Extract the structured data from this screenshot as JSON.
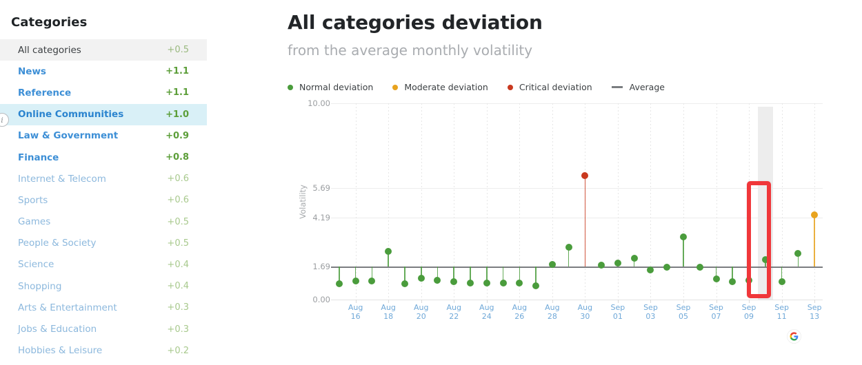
{
  "sidebar": {
    "title": "Categories",
    "info_icon": "info-icon",
    "items": [
      {
        "label": "All categories",
        "value": "+0.5",
        "style": "neutral"
      },
      {
        "label": "News",
        "value": "+1.1",
        "style": "strong"
      },
      {
        "label": "Reference",
        "value": "+1.1",
        "style": "strong"
      },
      {
        "label": "Online Communities",
        "value": "+1.0",
        "style": "sel"
      },
      {
        "label": "Law & Government",
        "value": "+0.9",
        "style": "strong"
      },
      {
        "label": "Finance",
        "value": "+0.8",
        "style": "strong"
      },
      {
        "label": "Internet & Telecom",
        "value": "+0.6",
        "style": "light"
      },
      {
        "label": "Sports",
        "value": "+0.6",
        "style": "light"
      },
      {
        "label": "Games",
        "value": "+0.5",
        "style": "light"
      },
      {
        "label": "People & Society",
        "value": "+0.5",
        "style": "light"
      },
      {
        "label": "Science",
        "value": "+0.4",
        "style": "light"
      },
      {
        "label": "Shopping",
        "value": "+0.4",
        "style": "light"
      },
      {
        "label": "Arts & Entertainment",
        "value": "+0.3",
        "style": "light"
      },
      {
        "label": "Jobs & Education",
        "value": "+0.3",
        "style": "light"
      },
      {
        "label": "Hobbies & Leisure",
        "value": "+0.2",
        "style": "light"
      }
    ]
  },
  "main": {
    "title": "All categories deviation",
    "subtitle": "from the average monthly volatility",
    "source_logo": "google-logo",
    "highlight_annotation": "red-highlight-box"
  },
  "colors": {
    "normal": "#4a9c3c",
    "moderate": "#e8a31e",
    "critical": "#c9391f",
    "average_line": "#7a7d80",
    "highlight": "#f0373a",
    "band": "#ededed",
    "link": "#3d8fd6",
    "positive": "#5c9e39"
  },
  "chart_data": {
    "type": "scatter",
    "title": "All categories deviation",
    "subtitle": "from the average monthly volatility",
    "xlabel": "",
    "ylabel": "Volatility",
    "ylim": [
      0.0,
      10.0
    ],
    "yticks": [
      0.0,
      1.69,
      4.19,
      5.69,
      10.0
    ],
    "ytick_labels": [
      "0.00",
      "1.69",
      "4.19",
      "5.69",
      "10.00"
    ],
    "grid": true,
    "legend_position": "top-left",
    "average": 1.69,
    "legend": [
      {
        "label": "Normal deviation",
        "color": "#4a9c3c",
        "marker": "dot"
      },
      {
        "label": "Moderate deviation",
        "color": "#e8a31e",
        "marker": "dot"
      },
      {
        "label": "Critical deviation",
        "color": "#c9391f",
        "marker": "dot"
      },
      {
        "label": "Average",
        "color": "#7a7d80",
        "marker": "line"
      }
    ],
    "xtick_labels": [
      "Aug 16",
      "Aug 18",
      "Aug 20",
      "Aug 22",
      "Aug 24",
      "Aug 26",
      "Aug 28",
      "Aug 30",
      "Sep 01",
      "Sep 03",
      "Sep 05",
      "Sep 07",
      "Sep 09",
      "Sep 11",
      "Sep 13"
    ],
    "highlighted_date": "Sep 10",
    "points": [
      {
        "date": "Aug 15",
        "value": 0.8,
        "level": "normal"
      },
      {
        "date": "Aug 16",
        "value": 0.95,
        "level": "normal"
      },
      {
        "date": "Aug 17",
        "value": 0.95,
        "level": "normal"
      },
      {
        "date": "Aug 18",
        "value": 2.45,
        "level": "normal"
      },
      {
        "date": "Aug 19",
        "value": 0.8,
        "level": "normal"
      },
      {
        "date": "Aug 20",
        "value": 1.1,
        "level": "normal"
      },
      {
        "date": "Aug 21",
        "value": 1.0,
        "level": "normal"
      },
      {
        "date": "Aug 22",
        "value": 0.9,
        "level": "normal"
      },
      {
        "date": "Aug 23",
        "value": 0.85,
        "level": "normal"
      },
      {
        "date": "Aug 24",
        "value": 0.85,
        "level": "normal"
      },
      {
        "date": "Aug 25",
        "value": 0.85,
        "level": "normal"
      },
      {
        "date": "Aug 26",
        "value": 0.85,
        "level": "normal"
      },
      {
        "date": "Aug 27",
        "value": 0.7,
        "level": "normal"
      },
      {
        "date": "Aug 28",
        "value": 1.8,
        "level": "normal"
      },
      {
        "date": "Aug 29",
        "value": 2.65,
        "level": "normal"
      },
      {
        "date": "Aug 30",
        "value": 6.3,
        "level": "critical"
      },
      {
        "date": "Aug 31",
        "value": 1.75,
        "level": "normal"
      },
      {
        "date": "Sep 01",
        "value": 1.85,
        "level": "normal"
      },
      {
        "date": "Sep 02",
        "value": 2.1,
        "level": "normal"
      },
      {
        "date": "Sep 03",
        "value": 1.5,
        "level": "normal"
      },
      {
        "date": "Sep 04",
        "value": 1.65,
        "level": "normal"
      },
      {
        "date": "Sep 05",
        "value": 3.2,
        "level": "normal"
      },
      {
        "date": "Sep 06",
        "value": 1.65,
        "level": "normal"
      },
      {
        "date": "Sep 07",
        "value": 1.05,
        "level": "normal"
      },
      {
        "date": "Sep 08",
        "value": 0.9,
        "level": "normal"
      },
      {
        "date": "Sep 09",
        "value": 1.0,
        "level": "normal"
      },
      {
        "date": "Sep 10",
        "value": 2.05,
        "level": "normal"
      },
      {
        "date": "Sep 11",
        "value": 0.9,
        "level": "normal"
      },
      {
        "date": "Sep 12",
        "value": 2.35,
        "level": "normal"
      },
      {
        "date": "Sep 13",
        "value": 4.3,
        "level": "moderate"
      }
    ]
  }
}
